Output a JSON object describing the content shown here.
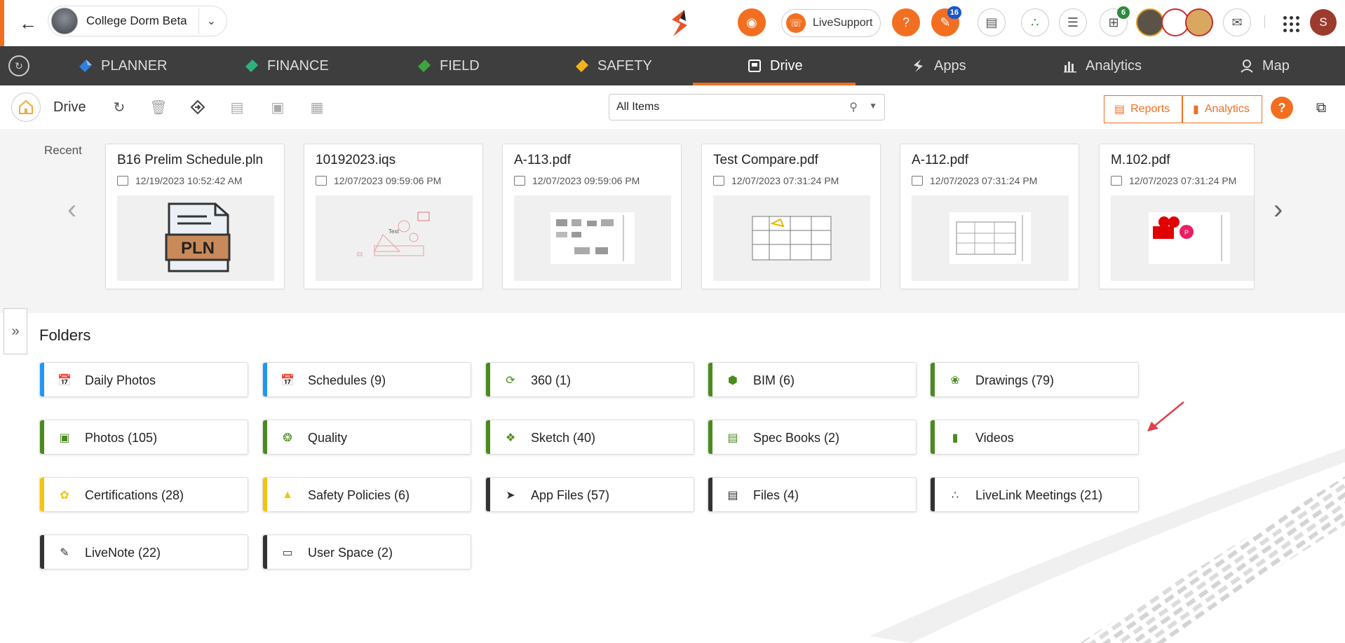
{
  "header": {
    "project_name": "College Dorm Beta",
    "livesupport_label": "LiveSupport",
    "notif_badge": "16",
    "cart_badge": "6",
    "user_initial": "S",
    "help_glyph": "?"
  },
  "nav": {
    "items": [
      {
        "label": "PLANNER",
        "icon": "planner-icon",
        "color": "#2f7fe0"
      },
      {
        "label": "FINANCE",
        "icon": "finance-icon",
        "color": "#2db37a"
      },
      {
        "label": "FIELD",
        "icon": "field-icon",
        "color": "#3fa33f"
      },
      {
        "label": "SAFETY",
        "icon": "safety-icon",
        "color": "#f2b21b"
      },
      {
        "label": "Drive",
        "icon": "drive-icon",
        "color": "#ffffff"
      },
      {
        "label": "Apps",
        "icon": "apps-icon",
        "color": "#dddddd"
      },
      {
        "label": "Analytics",
        "icon": "analytics-icon",
        "color": "#dddddd"
      },
      {
        "label": "Map",
        "icon": "map-icon",
        "color": "#dddddd"
      }
    ],
    "active": "Drive",
    "accent": "#f26f21"
  },
  "toolbar": {
    "title": "Drive",
    "filter_value": "All Items",
    "reports_label": "Reports",
    "analytics_label": "Analytics"
  },
  "recent": {
    "label": "Recent",
    "items": [
      {
        "name": "B16 Prelim Schedule.pln",
        "date": "12/19/2023 10:52:42 AM",
        "thumb": "pln"
      },
      {
        "name": "10192023.iqs",
        "date": "12/07/2023 09:59:06 PM",
        "thumb": "sketch"
      },
      {
        "name": "A-113.pdf",
        "date": "12/07/2023 09:59:06 PM",
        "thumb": "drawing"
      },
      {
        "name": "Test Compare.pdf",
        "date": "12/07/2023 07:31:24 PM",
        "thumb": "plan"
      },
      {
        "name": "A-112.pdf",
        "date": "12/07/2023 07:31:24 PM",
        "thumb": "plan2"
      },
      {
        "name": "M.102.pdf",
        "date": "12/07/2023 07:31:24 PM",
        "thumb": "markup"
      }
    ],
    "pln_text": "PLN",
    "sketch_text": "Text",
    "markup_letter": "P"
  },
  "folders": {
    "title": "Folders",
    "items": [
      {
        "label": "Daily Photos",
        "icon": "calendar-photo-icon",
        "color": "#2196f3"
      },
      {
        "label": "Schedules (9)",
        "icon": "calendar-icon",
        "color": "#2196f3"
      },
      {
        "label": "360 (1)",
        "icon": "360-icon",
        "color": "#4a8a1f"
      },
      {
        "label": "BIM (6)",
        "icon": "cube-icon",
        "color": "#4a8a1f"
      },
      {
        "label": "Drawings (79)",
        "icon": "compass-icon",
        "color": "#4a8a1f"
      },
      {
        "label": "Photos (105)",
        "icon": "image-icon",
        "color": "#4a8a1f"
      },
      {
        "label": "Quality",
        "icon": "badge-icon",
        "color": "#4a8a1f"
      },
      {
        "label": "Sketch (40)",
        "icon": "sketch-icon",
        "color": "#4a8a1f"
      },
      {
        "label": "Spec Books (2)",
        "icon": "book-icon",
        "color": "#4a8a1f"
      },
      {
        "label": "Videos",
        "icon": "video-icon",
        "color": "#4a8a1f"
      },
      {
        "label": "Certifications (28)",
        "icon": "certificate-icon",
        "color": "#f2c40f"
      },
      {
        "label": "Safety Policies (6)",
        "icon": "cone-icon",
        "color": "#f2c40f"
      },
      {
        "label": "App Files (57)",
        "icon": "app-logo-icon",
        "color": "#333333"
      },
      {
        "label": "Files (4)",
        "icon": "file-icon",
        "color": "#333333"
      },
      {
        "label": "LiveLink Meetings (21)",
        "icon": "meeting-icon",
        "color": "#333333"
      },
      {
        "label": "LiveNote (22)",
        "icon": "note-icon",
        "color": "#333333"
      },
      {
        "label": "User Space (2)",
        "icon": "drive-space-icon",
        "color": "#333333"
      }
    ]
  }
}
